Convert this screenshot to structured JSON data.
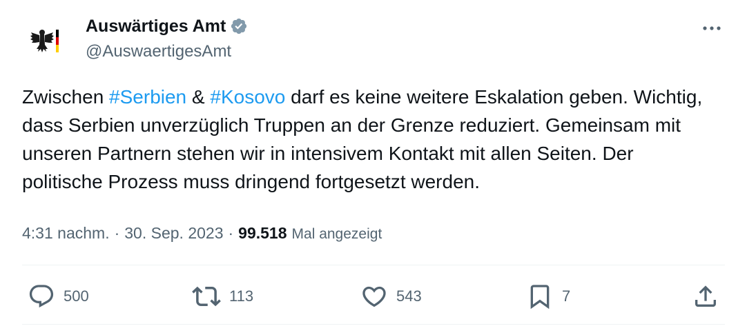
{
  "author": {
    "display_name": "Auswärtiges Amt",
    "handle": "@AuswaertigesAmt",
    "verified_badge_color": "#829aab",
    "avatar_icon": "federal-eagle-flag-icon"
  },
  "tweet": {
    "text_segments": [
      {
        "text": "Zwischen ",
        "type": "text"
      },
      {
        "text": "#Serbien",
        "type": "hashtag"
      },
      {
        "text": " & ",
        "type": "text"
      },
      {
        "text": "#Kosovo",
        "type": "hashtag"
      },
      {
        "text": " darf es keine weitere Eskalation geben. Wichtig, dass Serbien unverzüglich Truppen an der Grenze reduziert. Gemeinsam mit unseren Partnern stehen wir in intensivem Kontakt mit allen Seiten. Der politische Prozess muss dringend fortgesetzt werden.",
        "type": "text"
      }
    ],
    "time": "4:31 nachm.",
    "date": "30. Sep. 2023",
    "views_count": "99.518",
    "views_label": "Mal angezeigt"
  },
  "actions": {
    "reply_count": "500",
    "retweet_count": "113",
    "like_count": "543",
    "bookmark_count": "7"
  },
  "colors": {
    "link": "#1d9bf0",
    "secondary_text": "#536471",
    "primary_text": "#0f1419"
  }
}
